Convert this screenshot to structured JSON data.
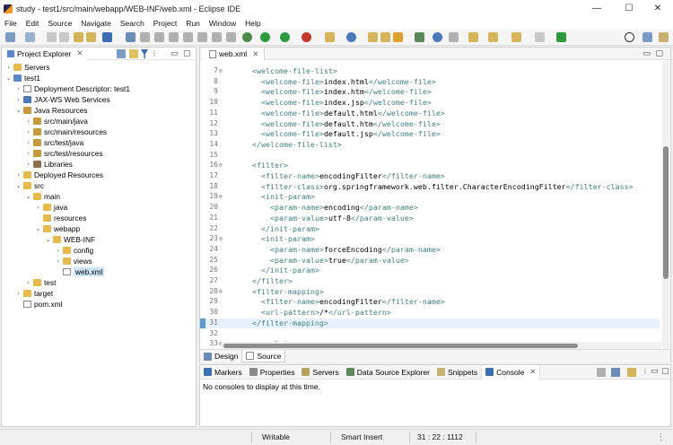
{
  "window": {
    "title": "study - test1/src/main/webapp/WEB-INF/web.xml - Eclipse IDE",
    "minimize_glyph": "—",
    "maximize_glyph": "☐",
    "close_glyph": "✕"
  },
  "menu": [
    "File",
    "Edit",
    "Source",
    "Navigate",
    "Search",
    "Project",
    "Run",
    "Window",
    "Help"
  ],
  "explorer": {
    "title": "Project Explorer",
    "tree": [
      {
        "label": "Servers",
        "depth": 0,
        "chev": "›",
        "icon": "folder"
      },
      {
        "label": "test1",
        "depth": 0,
        "chev": "⌄",
        "icon": "proj"
      },
      {
        "label": "Deployment Descriptor: test1",
        "depth": 1,
        "chev": "›",
        "icon": "file"
      },
      {
        "label": "JAX-WS Web Services",
        "depth": 1,
        "chev": "›",
        "icon": "jaxws"
      },
      {
        "label": "Java Resources",
        "depth": 1,
        "chev": "⌄",
        "icon": "pkgf"
      },
      {
        "label": "src/main/java",
        "depth": 2,
        "chev": "›",
        "icon": "pkgf"
      },
      {
        "label": "src/main/resources",
        "depth": 2,
        "chev": "›",
        "icon": "pkgf"
      },
      {
        "label": "src/test/java",
        "depth": 2,
        "chev": "›",
        "icon": "pkgf"
      },
      {
        "label": "src/test/resources",
        "depth": 2,
        "chev": "›",
        "icon": "pkgf"
      },
      {
        "label": "Libraries",
        "depth": 2,
        "chev": "›",
        "icon": "lib"
      },
      {
        "label": "Deployed Resources",
        "depth": 1,
        "chev": "›",
        "icon": "folder"
      },
      {
        "label": "src",
        "depth": 1,
        "chev": "⌄",
        "icon": "folder"
      },
      {
        "label": "main",
        "depth": 2,
        "chev": "⌄",
        "icon": "folder"
      },
      {
        "label": "java",
        "depth": 3,
        "chev": "›",
        "icon": "folder"
      },
      {
        "label": "resources",
        "depth": 3,
        "chev": "",
        "icon": "folder"
      },
      {
        "label": "webapp",
        "depth": 3,
        "chev": "⌄",
        "icon": "folder"
      },
      {
        "label": "WEB-INF",
        "depth": 4,
        "chev": "⌄",
        "icon": "folder"
      },
      {
        "label": "config",
        "depth": 5,
        "chev": "›",
        "icon": "folder"
      },
      {
        "label": "views",
        "depth": 5,
        "chev": "›",
        "icon": "folder"
      },
      {
        "label": "web.xml",
        "depth": 5,
        "chev": "",
        "icon": "file",
        "selected": true
      },
      {
        "label": "test",
        "depth": 2,
        "chev": "›",
        "icon": "folder"
      },
      {
        "label": "target",
        "depth": 1,
        "chev": "›",
        "icon": "folder"
      },
      {
        "label": "pom.xml",
        "depth": 1,
        "chev": "",
        "icon": "file"
      }
    ]
  },
  "editor": {
    "tab_label": "web.xml",
    "lines": [
      {
        "n": "7",
        "fold": "⊖",
        "indent": 2,
        "segs": [
          [
            "tag",
            "<welcome-file-list>"
          ]
        ]
      },
      {
        "n": "8",
        "indent": 4,
        "segs": [
          [
            "tag",
            "<welcome-file>"
          ],
          [
            "txt",
            "index.html"
          ],
          [
            "tag",
            "</welcome-file>"
          ]
        ]
      },
      {
        "n": "9",
        "indent": 4,
        "segs": [
          [
            "tag",
            "<welcome-file>"
          ],
          [
            "txt",
            "index.htm"
          ],
          [
            "tag",
            "</welcome-file>"
          ]
        ]
      },
      {
        "n": "10",
        "indent": 4,
        "segs": [
          [
            "tag",
            "<welcome-file>"
          ],
          [
            "txt",
            "index.jsp"
          ],
          [
            "tag",
            "</welcome-file>"
          ]
        ]
      },
      {
        "n": "11",
        "indent": 4,
        "segs": [
          [
            "tag",
            "<welcome-file>"
          ],
          [
            "txt",
            "default.html"
          ],
          [
            "tag",
            "</welcome-file>"
          ]
        ]
      },
      {
        "n": "12",
        "indent": 4,
        "segs": [
          [
            "tag",
            "<welcome-file>"
          ],
          [
            "txt",
            "default.htm"
          ],
          [
            "tag",
            "</welcome-file>"
          ]
        ]
      },
      {
        "n": "13",
        "indent": 4,
        "segs": [
          [
            "tag",
            "<welcome-file>"
          ],
          [
            "txt",
            "default.jsp"
          ],
          [
            "tag",
            "</welcome-file>"
          ]
        ]
      },
      {
        "n": "14",
        "indent": 2,
        "segs": [
          [
            "tag",
            "</welcome-file-list>"
          ]
        ]
      },
      {
        "n": "15",
        "indent": 0,
        "segs": []
      },
      {
        "n": "16",
        "fold": "⊖",
        "indent": 2,
        "segs": [
          [
            "tag",
            "<filter>"
          ]
        ]
      },
      {
        "n": "17",
        "indent": 4,
        "segs": [
          [
            "tag",
            "<filter-name>"
          ],
          [
            "txt",
            "encodingFilter"
          ],
          [
            "tag",
            "</filter-name>"
          ]
        ]
      },
      {
        "n": "18",
        "indent": 4,
        "segs": [
          [
            "tag",
            "<filter-class>"
          ],
          [
            "txt",
            "org.springframework.web.filter.CharacterEncodingFilter"
          ],
          [
            "tag",
            "</filter-class>"
          ]
        ]
      },
      {
        "n": "19",
        "fold": "⊖",
        "indent": 4,
        "segs": [
          [
            "tag",
            "<init-param>"
          ]
        ]
      },
      {
        "n": "20",
        "indent": 6,
        "segs": [
          [
            "tag",
            "<param-name>"
          ],
          [
            "txt",
            "encoding"
          ],
          [
            "tag",
            "</param-name>"
          ]
        ]
      },
      {
        "n": "21",
        "indent": 6,
        "segs": [
          [
            "tag",
            "<param-value>"
          ],
          [
            "txt",
            "utf-8"
          ],
          [
            "tag",
            "</param-value>"
          ]
        ]
      },
      {
        "n": "22",
        "indent": 4,
        "segs": [
          [
            "tag",
            "</init-param>"
          ]
        ]
      },
      {
        "n": "23",
        "fold": "⊖",
        "indent": 4,
        "segs": [
          [
            "tag",
            "<init-param>"
          ]
        ]
      },
      {
        "n": "24",
        "indent": 6,
        "segs": [
          [
            "tag",
            "<param-name>"
          ],
          [
            "txt",
            "forceEncoding"
          ],
          [
            "tag",
            "</param-name>"
          ]
        ]
      },
      {
        "n": "25",
        "indent": 6,
        "segs": [
          [
            "tag",
            "<param-value>"
          ],
          [
            "txt",
            "true"
          ],
          [
            "tag",
            "</param-value>"
          ]
        ]
      },
      {
        "n": "26",
        "indent": 4,
        "segs": [
          [
            "tag",
            "</init-param>"
          ]
        ]
      },
      {
        "n": "27",
        "indent": 2,
        "segs": [
          [
            "tag",
            "</filter>"
          ]
        ]
      },
      {
        "n": "28",
        "fold": "⊖",
        "indent": 2,
        "segs": [
          [
            "tag",
            "<filter-mapping>"
          ]
        ]
      },
      {
        "n": "29",
        "indent": 4,
        "segs": [
          [
            "tag",
            "<filter-name>"
          ],
          [
            "txt",
            "encodingFilter"
          ],
          [
            "tag",
            "</filter-name>"
          ]
        ]
      },
      {
        "n": "30",
        "indent": 4,
        "segs": [
          [
            "tag",
            "<url-pattern>"
          ],
          [
            "txt",
            "/*"
          ],
          [
            "tag",
            "</url-pattern>"
          ]
        ]
      },
      {
        "n": "31",
        "indent": 2,
        "highlight": true,
        "segs": [
          [
            "tag",
            "</filter-mapping>"
          ]
        ]
      },
      {
        "n": "32",
        "indent": 0,
        "segs": []
      },
      {
        "n": "33",
        "fold": "⊖",
        "indent": 2,
        "segs": [
          [
            "tag",
            "<servlet>"
          ]
        ]
      }
    ],
    "bottom_tabs": [
      "Design",
      "Source"
    ]
  },
  "console": {
    "tabs": [
      "Markers",
      "Properties",
      "Servers",
      "Data Source Explorer",
      "Snippets",
      "Console"
    ],
    "active_tab": "Console",
    "message": "No consoles to display at this time."
  },
  "status": {
    "mode": "Writable",
    "insert": "Smart Insert",
    "position": "31 : 22 : 1112"
  },
  "colors": {
    "xml_tag": "#3f7f7f",
    "selection": "#cce4f7",
    "current_line": "#e8f2fe"
  }
}
